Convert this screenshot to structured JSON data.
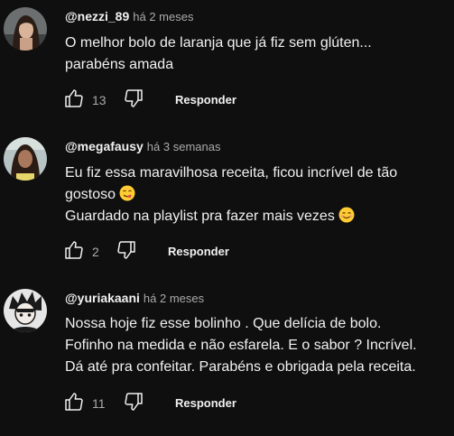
{
  "reply_label": "Responder",
  "icons": {
    "like": "thumbs-up-icon",
    "dislike": "thumbs-down-icon",
    "emoji_yum": "face-savoring-food-emoji",
    "emoji_smile": "smiling-face-emoji"
  },
  "colors": {
    "background": "#0f0f0f",
    "primary_text": "#f1f1f1",
    "secondary_text": "#aaaaaa"
  },
  "comments": [
    {
      "author": "@nezzi_89",
      "time": "há 2 meses",
      "lines": [
        "O melhor bolo de laranja que já fiz sem glúten...",
        "parabéns amada"
      ],
      "likes": "13"
    },
    {
      "author": "@megafausy",
      "time": "há 3 semanas",
      "lines": [
        "Eu fiz essa maravilhosa receita, ficou incrível de tão",
        "gostoso",
        "Guardado na playlist pra fazer mais vezes"
      ],
      "likes": "2"
    },
    {
      "author": "@yuriakaani",
      "time": "há 2 meses",
      "lines": [
        "Nossa hoje fiz esse bolinho . Que delícia de bolo.",
        "Fofinho na medida e não esfarela. E o sabor ? Incrível.",
        "Dá até pra confeitar. Parabéns e obrigada pela receita."
      ],
      "likes": "11"
    }
  ]
}
